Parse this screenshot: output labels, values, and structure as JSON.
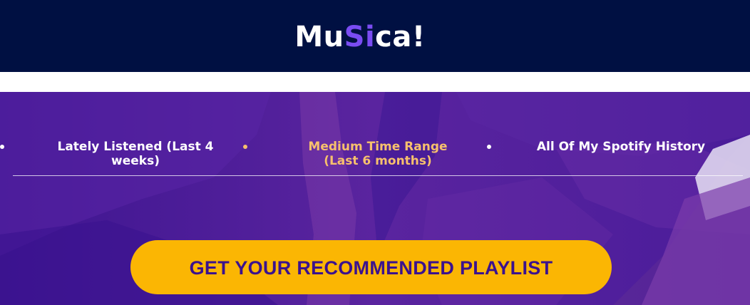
{
  "header": {
    "logo_part1": "Mu",
    "logo_accent": "Si",
    "logo_part2": "ca!",
    "background_color": "#001042",
    "accent_color": "#7a4cf2"
  },
  "time_range_tabs": {
    "active_index": 1,
    "active_color": "#f7c06d",
    "items": [
      {
        "label": "Lately Listened (Last 4 weeks)"
      },
      {
        "label": "Medium Time Range (Last 6 months)"
      },
      {
        "label": "All Of My Spotify History"
      }
    ]
  },
  "cta": {
    "label": "GET YOUR RECOMMENDED PLAYLIST",
    "background_color": "#fbb603",
    "text_color": "#3b128e"
  },
  "hero": {
    "background_color": "#4a1b9b"
  }
}
